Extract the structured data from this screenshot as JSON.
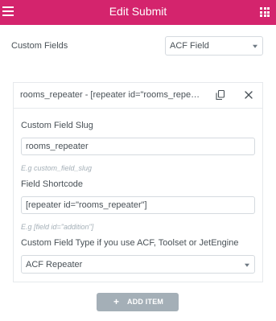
{
  "header": {
    "title": "Edit Submit",
    "menu_icon": "hamburger-menu-icon",
    "apps_icon": "grid-apps-icon",
    "color": "#d4246d"
  },
  "custom_fields": {
    "label": "Custom Fields",
    "selected": "ACF Field"
  },
  "repeater_item": {
    "title": "rooms_repeater - [repeater id=\"rooms_repeater\"]",
    "duplicate_icon": "copy-icon",
    "remove_icon": "close-icon",
    "slug_label": "Custom Field Slug",
    "slug_value": "rooms_repeater",
    "slug_note": "E.g custom_field_slug",
    "shortcode_label": "Field Shortcode",
    "shortcode_value": "[repeater id=\"rooms_repeater\"]",
    "shortcode_note": "E.g [field id=\"addition\"]",
    "type_label": "Custom Field Type if you use ACF, Toolset or JetEngine",
    "type_selected": "ACF Repeater"
  },
  "add_item": {
    "icon": "+",
    "label": "ADD ITEM",
    "color": "#a4afb7"
  }
}
